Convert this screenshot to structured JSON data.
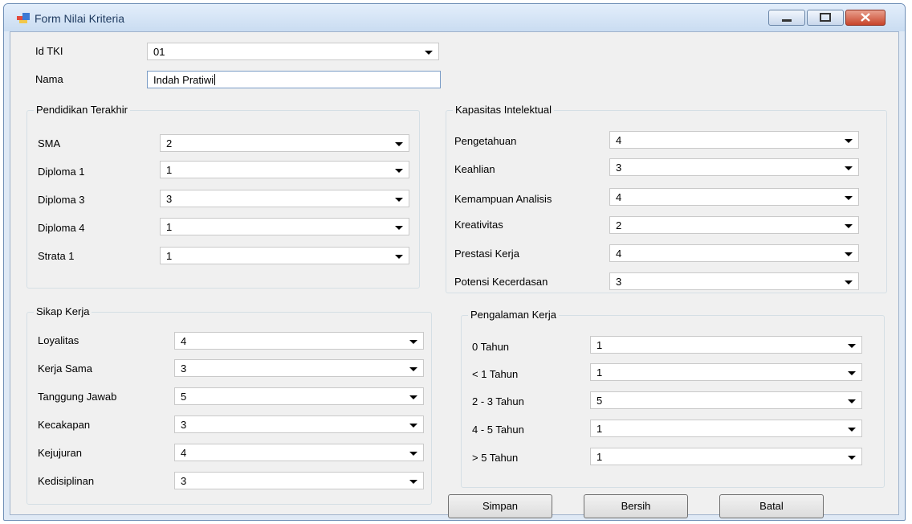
{
  "window": {
    "title": "Form Nilai Kriteria"
  },
  "header": {
    "id_label": "Id TKI",
    "id_value": "01",
    "nama_label": "Nama",
    "nama_value": "Indah Pratiwi"
  },
  "pendidikan": {
    "title": "Pendidikan Terakhir",
    "rows": [
      {
        "label": "SMA",
        "value": "2"
      },
      {
        "label": "Diploma 1",
        "value": "1"
      },
      {
        "label": "Diploma 3",
        "value": "3"
      },
      {
        "label": "Diploma 4",
        "value": "1"
      },
      {
        "label": "Strata 1",
        "value": "1"
      }
    ]
  },
  "kapasitas": {
    "title": "Kapasitas Intelektual",
    "rows": [
      {
        "label": "Pengetahuan",
        "value": "4"
      },
      {
        "label": "Keahlian",
        "value": "3"
      },
      {
        "label": "Kemampuan Analisis",
        "value": "4"
      },
      {
        "label": "Kreativitas",
        "value": "2"
      },
      {
        "label": "Prestasi Kerja",
        "value": "4"
      },
      {
        "label": "Potensi Kecerdasan",
        "value": "3"
      }
    ]
  },
  "sikap": {
    "title": "Sikap Kerja",
    "rows": [
      {
        "label": "Loyalitas",
        "value": "4"
      },
      {
        "label": "Kerja Sama",
        "value": "3"
      },
      {
        "label": "Tanggung Jawab",
        "value": "5"
      },
      {
        "label": "Kecakapan",
        "value": "3"
      },
      {
        "label": "Kejujuran",
        "value": "4"
      },
      {
        "label": "Kedisiplinan",
        "value": "3"
      }
    ]
  },
  "pengalaman": {
    "title": "Pengalaman Kerja",
    "rows": [
      {
        "label": "0 Tahun",
        "value": "1"
      },
      {
        "label": "< 1 Tahun",
        "value": "1"
      },
      {
        "label": "2 - 3 Tahun",
        "value": "5"
      },
      {
        "label": "4 - 5 Tahun",
        "value": "1"
      },
      {
        "label": "> 5 Tahun",
        "value": "1"
      }
    ]
  },
  "buttons": {
    "simpan": "Simpan",
    "bersih": "Bersih",
    "batal": "Batal"
  }
}
